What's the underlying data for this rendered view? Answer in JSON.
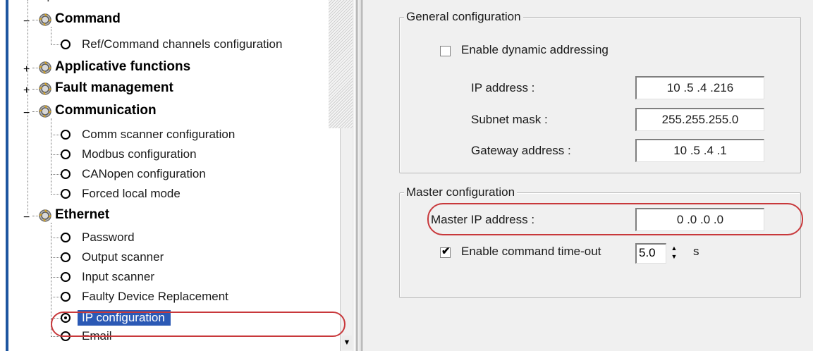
{
  "tree": {
    "top_stub": ".",
    "categories": [
      {
        "label": "Command",
        "expander": "−",
        "children": [
          "Ref/Command channels configuration"
        ]
      },
      {
        "label": "Applicative functions",
        "expander": "+",
        "children": []
      },
      {
        "label": "Fault management",
        "expander": "+",
        "children": []
      },
      {
        "label": "Communication",
        "expander": "−",
        "children": [
          "Comm scanner configuration",
          "Modbus configuration",
          "CANopen configuration",
          "Forced local mode"
        ]
      },
      {
        "label": "Ethernet",
        "expander": "−",
        "children": [
          "Password",
          "Output scanner",
          "Input scanner",
          "Faulty Device Replacement",
          "IP configuration",
          "Email"
        ]
      }
    ],
    "selected_item": "IP configuration",
    "scroll_down_glyph": "▼"
  },
  "general_config": {
    "title": "General configuration",
    "dynamic_addressing_label": "Enable dynamic addressing",
    "dynamic_addressing_checked": false,
    "ip_label": "IP address :",
    "ip_value": "10 .5 .4 .216",
    "subnet_label": "Subnet mask :",
    "subnet_value": "255.255.255.0",
    "gateway_label": "Gateway address :",
    "gateway_value": "10 .5 .4 .1"
  },
  "master_config": {
    "title": "Master configuration",
    "master_ip_label": "Master IP address :",
    "master_ip_value": "0 .0 .0 .0",
    "timeout_label": "Enable command time-out",
    "timeout_checked": true,
    "check_glyph": "✔",
    "timeout_value": "5.0",
    "timeout_unit": "s",
    "spin_up": "▲",
    "spin_down": "▼"
  },
  "colors": {
    "selection": "#2b59b5",
    "highlight_ring": "#c8383b",
    "panel_bg": "#f0f0f0",
    "tree_border": "#1e56a0"
  }
}
